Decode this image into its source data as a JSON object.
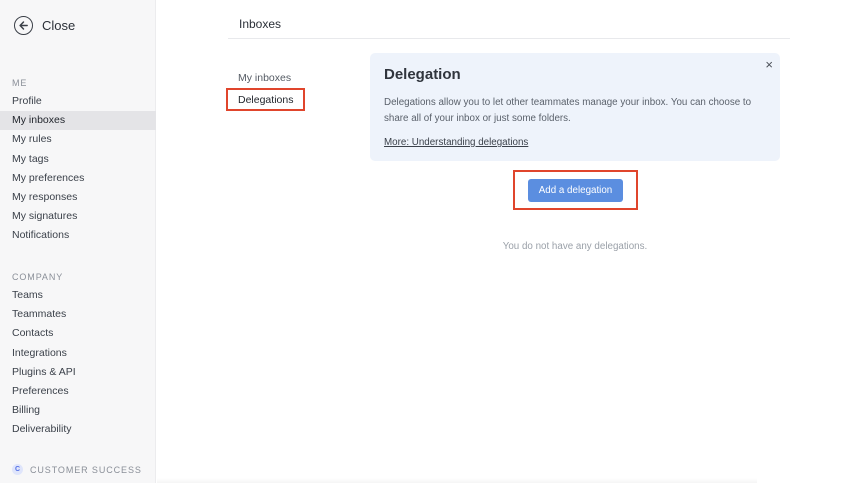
{
  "close": {
    "label": "Close",
    "icon": "arrow-left-circle-icon"
  },
  "sidebar": {
    "me_label": "ME",
    "me_items": [
      {
        "label": "Profile"
      },
      {
        "label": "My inboxes",
        "active": true
      },
      {
        "label": "My rules"
      },
      {
        "label": "My tags"
      },
      {
        "label": "My preferences"
      },
      {
        "label": "My responses"
      },
      {
        "label": "My signatures"
      },
      {
        "label": "Notifications"
      }
    ],
    "company_label": "COMPANY",
    "company_items": [
      {
        "label": "Teams"
      },
      {
        "label": "Teammates"
      },
      {
        "label": "Contacts"
      },
      {
        "label": "Integrations"
      },
      {
        "label": "Plugins & API"
      },
      {
        "label": "Preferences"
      },
      {
        "label": "Billing"
      },
      {
        "label": "Deliverability"
      }
    ],
    "customer_success": {
      "badge": "C",
      "label": "CUSTOMER SUCCESS"
    }
  },
  "main": {
    "title": "Inboxes",
    "subnav": [
      {
        "label": "My inboxes"
      },
      {
        "label": "Delegations",
        "active": true
      }
    ],
    "info": {
      "title": "Delegation",
      "text": "Delegations allow you to let other teammates manage your inbox. You can choose to share all of your inbox or just some folders.",
      "link": "More: Understanding delegations",
      "close": "×"
    },
    "add_button": "Add a delegation",
    "empty": "You do not have any delegations."
  },
  "colors": {
    "accent": "#5b8ee0",
    "highlight": "#e0452c",
    "info_bg": "#eef3fb",
    "sidebar_bg": "#f7f7f8"
  }
}
